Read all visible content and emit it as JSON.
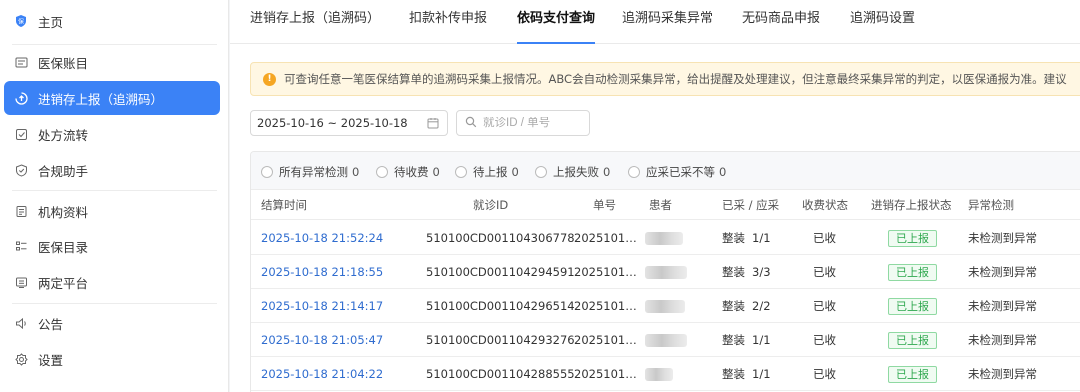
{
  "sidebar": {
    "items": [
      {
        "label": "主页",
        "icon": "shield-logo-icon"
      },
      {
        "label": "医保账目",
        "icon": "ledger-icon"
      },
      {
        "label": "进销存上报（追溯码）",
        "icon": "upload-icon",
        "active": true
      },
      {
        "label": "处方流转",
        "icon": "checklist-icon"
      },
      {
        "label": "合规助手",
        "icon": "shield-check-icon"
      },
      {
        "label": "机构资料",
        "icon": "document-icon"
      },
      {
        "label": "医保目录",
        "icon": "catalog-icon"
      },
      {
        "label": "两定平台",
        "icon": "platform-icon"
      },
      {
        "label": "公告",
        "icon": "speaker-icon"
      },
      {
        "label": "设置",
        "icon": "gear-icon"
      }
    ]
  },
  "tabs": [
    {
      "label": "进销存上报（追溯码）"
    },
    {
      "label": "扣款补传申报"
    },
    {
      "label": "依码支付查询",
      "active": true
    },
    {
      "label": "追溯码采集异常"
    },
    {
      "label": "无码商品申报"
    },
    {
      "label": "追溯码设置"
    }
  ],
  "notice": {
    "text": "可查询任意一笔医保结算单的追溯码采集上报情况。ABC会自动检测采集异常，给出提醒及处理建议，但注意最终采集异常的判定，以医保通报为准。建议"
  },
  "toolbar": {
    "date_range": "2025-10-16 ~ 2025-10-18",
    "search_placeholder": "就诊ID / 单号"
  },
  "filters": [
    {
      "label": "所有异常检测",
      "count": "0"
    },
    {
      "label": "待收费",
      "count": "0"
    },
    {
      "label": "待上报",
      "count": "0"
    },
    {
      "label": "上报失败",
      "count": "0"
    },
    {
      "label": "应采已采不等",
      "count": "0"
    }
  ],
  "table": {
    "headers": {
      "time": "结算时间",
      "visit_id": "就诊ID",
      "order_no": "单号",
      "patient": "患者",
      "collected": "已采 / 应采",
      "charge_status": "收费状态",
      "report_status": "进销存上报状态",
      "anomaly": "异常检测"
    },
    "rows": [
      {
        "time": "2025-10-18 21:52:24",
        "visit_id": "510100CD001104306778",
        "order_no": "2025101…",
        "pack": "整装",
        "ratio": "1/1",
        "charge_status": "已收",
        "report_status": "已上报",
        "anomaly": "未检测到异常"
      },
      {
        "time": "2025-10-18 21:18:55",
        "visit_id": "510100CD001104294591",
        "order_no": "2025101…",
        "pack": "整装",
        "ratio": "3/3",
        "charge_status": "已收",
        "report_status": "已上报",
        "anomaly": "未检测到异常"
      },
      {
        "time": "2025-10-18 21:14:17",
        "visit_id": "510100CD001104296514",
        "order_no": "2025101…",
        "pack": "整装",
        "ratio": "2/2",
        "charge_status": "已收",
        "report_status": "已上报",
        "anomaly": "未检测到异常"
      },
      {
        "time": "2025-10-18 21:05:47",
        "visit_id": "510100CD001104293276",
        "order_no": "2025101…",
        "pack": "整装",
        "ratio": "1/1",
        "charge_status": "已收",
        "report_status": "已上报",
        "anomaly": "未检测到异常"
      },
      {
        "time": "2025-10-18 21:04:22",
        "visit_id": "510100CD001104288555",
        "order_no": "2025101…",
        "pack": "整装",
        "ratio": "1/1",
        "charge_status": "已收",
        "report_status": "已上报",
        "anomaly": "未检测到异常"
      }
    ]
  },
  "colors": {
    "accent": "#3b82f6",
    "link": "#2f6ccf",
    "success": "#2fa84f",
    "notice_bg": "#fff7e3"
  }
}
